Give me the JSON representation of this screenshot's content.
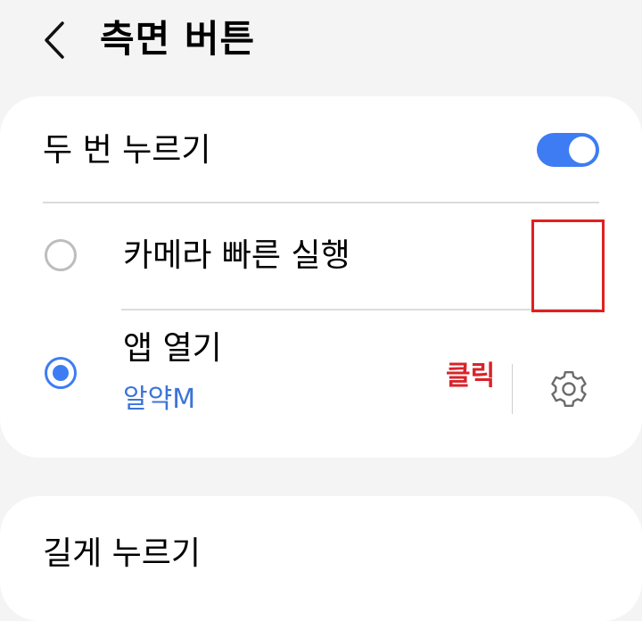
{
  "header": {
    "title": "측면 버튼",
    "back_icon": "chevron-left-icon"
  },
  "double_press": {
    "label": "두 번 누르기",
    "toggle_on": true,
    "accent_color": "#3e7cf4",
    "options": [
      {
        "label": "카메라 빠른 실행",
        "selected": false
      },
      {
        "label": "앱 열기",
        "sublabel": "알약M",
        "selected": true,
        "settings_icon": "gear-icon"
      }
    ]
  },
  "annotation": {
    "click_label": "클릭",
    "color": "#d9232a"
  },
  "long_press": {
    "label": "길게 누르기"
  }
}
